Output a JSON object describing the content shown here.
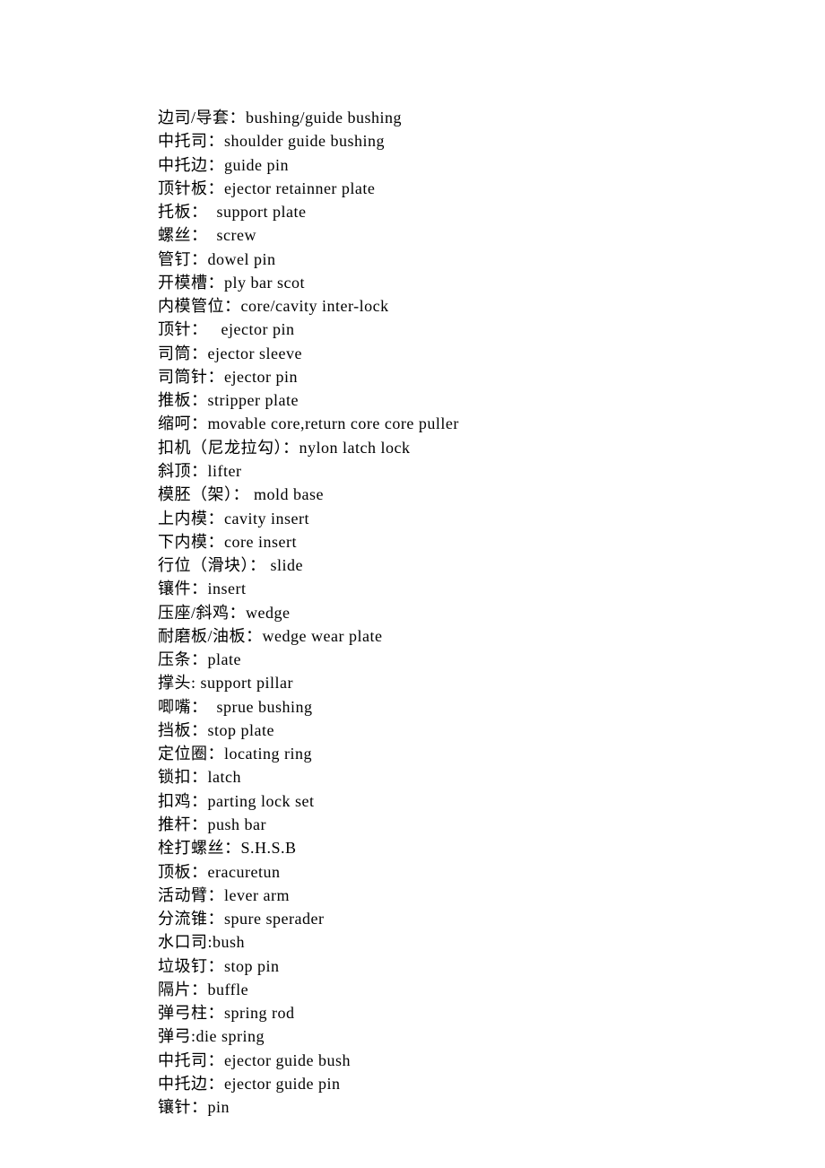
{
  "lines": [
    "边司/导套：bushing/guide bushing",
    "中托司：shoulder guide bushing",
    "中托边：guide pin",
    "顶针板：ejector retainner plate",
    "托板：  support plate",
    "螺丝：  screw",
    "管钉：dowel pin",
    "开模槽：ply bar scot",
    "内模管位：core/cavity inter-lock",
    "顶针：   ejector pin",
    "司筒：ejector sleeve",
    "司筒针：ejector pin",
    "推板：stripper plate",
    "缩呵：movable core,return core core puller",
    "扣机（尼龙拉勾）：nylon latch lock",
    "斜顶：lifter",
    "模胚（架）： mold base",
    "上内模：cavity insert",
    "下内模：core insert",
    "行位（滑块）： slide",
    "镶件：insert",
    "压座/斜鸡：wedge",
    "耐磨板/油板：wedge wear plate",
    "压条：plate",
    "撑头: support pillar",
    "唧嘴：  sprue bushing",
    "挡板：stop plate",
    "定位圈：locating ring",
    "锁扣：latch",
    "扣鸡：parting lock set",
    "推杆：push bar",
    "栓打螺丝：S.H.S.B",
    "顶板：eracuretun",
    "活动臂：lever arm",
    "分流锥：spure sperader",
    "水口司:bush",
    "垃圾钉：stop pin",
    "隔片：buffle",
    "弹弓柱：spring rod",
    "弹弓:die spring",
    "中托司：ejector guide bush",
    "中托边：ejector guide pin",
    "镶针：pin"
  ]
}
